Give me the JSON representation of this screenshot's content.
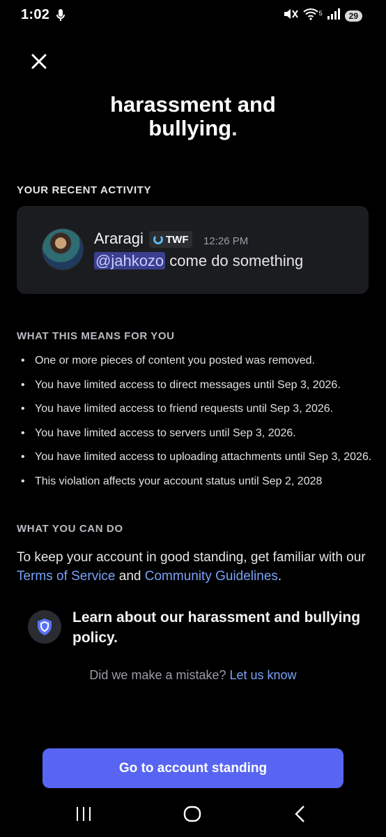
{
  "status_bar": {
    "time": "1:02",
    "battery": "29",
    "wifi_label": "5"
  },
  "header": {
    "title_line1": "harassment and",
    "title_line2": "bullying",
    "title_period": "."
  },
  "recent_activity": {
    "label": "YOUR RECENT ACTIVITY",
    "author": "Araragi",
    "tag": "TWF",
    "time": "12:26 PM",
    "mention": "@jahkozo",
    "message": " come do something"
  },
  "means": {
    "label": "WHAT THIS MEANS FOR YOU",
    "items": [
      "One or more pieces of content you posted was removed.",
      "You have limited access to direct messages until Sep 3, 2026.",
      "You have limited access to friend requests until Sep 3, 2026.",
      "You have limited access to servers until Sep 3, 2026.",
      "You have limited access to uploading attachments until Sep 3, 2026.",
      "This violation affects your account status until Sep 2, 2028"
    ]
  },
  "can_do": {
    "label": "WHAT YOU CAN DO",
    "text_before": "To keep your account in good standing, get familiar with our ",
    "tos_link": "Terms of Service",
    "text_and": " and ",
    "guidelines_link": "Community Guidelines",
    "text_after": "."
  },
  "policy": {
    "text": "Learn about our harassment and bullying policy."
  },
  "mistake": {
    "text": "Did we make a mistake? ",
    "link": "Let us know"
  },
  "cta": {
    "label": "Go to account standing"
  },
  "colors": {
    "accent": "#5865f2",
    "link": "#7aa2f7",
    "background": "#000000",
    "card": "#1b1c20"
  }
}
